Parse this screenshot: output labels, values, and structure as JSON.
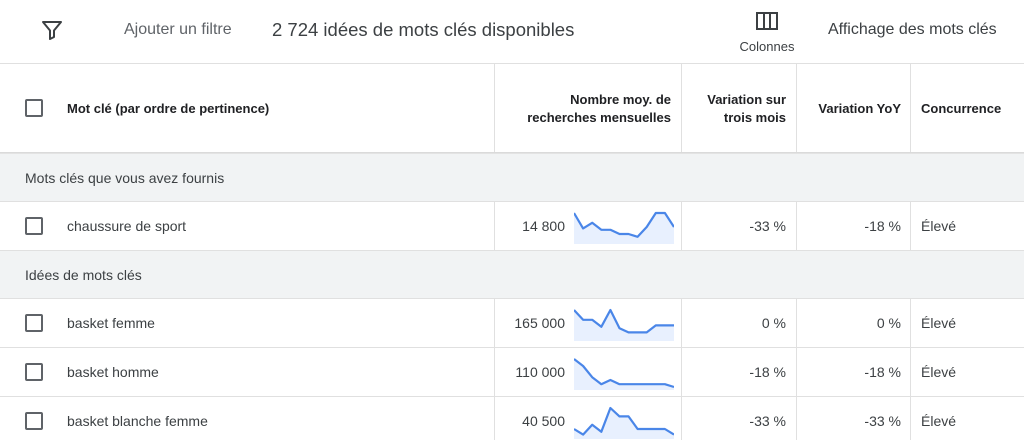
{
  "toolbar": {
    "add_filter_label": "Ajouter un filtre",
    "ideas_count": "2 724 idées de mots clés disponibles",
    "columns_label": "Colonnes",
    "keyword_view_label": "Affichage des mots clés"
  },
  "table": {
    "headers": {
      "keyword": "Mot clé (par ordre de pertinence)",
      "avg_searches_line1": "Nombre moy. de",
      "avg_searches_line2": "recherches mensuelles",
      "three_month_line1": "Variation sur",
      "three_month_line2": "trois mois",
      "yoy": "Variation YoY",
      "competition": "Concurrence"
    },
    "sections": [
      {
        "label": "Mots clés que vous avez fournis",
        "rows": [
          {
            "keyword": "chaussure de sport",
            "volume": "14 800",
            "change_3m": "-33 %",
            "change_yoy": "-18 %",
            "competition": "Élevé",
            "trend": [
              0.0,
              0.55,
              0.35,
              0.6,
              0.6,
              0.75,
              0.75,
              0.85,
              0.5,
              0.0,
              0.0,
              0.5
            ]
          }
        ]
      },
      {
        "label": "Idées de mots clés",
        "rows": [
          {
            "keyword": "basket femme",
            "volume": "165 000",
            "change_3m": "0 %",
            "change_yoy": "0 %",
            "competition": "Élevé",
            "trend": [
              0.0,
              0.35,
              0.35,
              0.6,
              0.0,
              0.65,
              0.8,
              0.8,
              0.8,
              0.55,
              0.55,
              0.55
            ]
          },
          {
            "keyword": "basket homme",
            "volume": "110 000",
            "change_3m": "-18 %",
            "change_yoy": "-18 %",
            "competition": "Élevé",
            "trend": [
              0.0,
              0.25,
              0.65,
              0.9,
              0.75,
              0.9,
              0.9,
              0.9,
              0.9,
              0.9,
              0.9,
              1.0
            ]
          },
          {
            "keyword": "basket blanche femme",
            "volume": "40 500",
            "change_3m": "-33 %",
            "change_yoy": "-33 %",
            "competition": "Élevé",
            "trend": [
              0.75,
              0.95,
              0.6,
              0.85,
              0.0,
              0.3,
              0.3,
              0.75,
              0.75,
              0.75,
              0.75,
              0.95
            ]
          }
        ]
      }
    ]
  },
  "colors": {
    "sparkline_line": "#4a86e8",
    "sparkline_fill": "#e8f0fe",
    "section_bg": "#f1f3f4",
    "border": "#e0e0e0"
  },
  "icons": {
    "filter": "filter-icon",
    "columns": "columns-icon"
  }
}
